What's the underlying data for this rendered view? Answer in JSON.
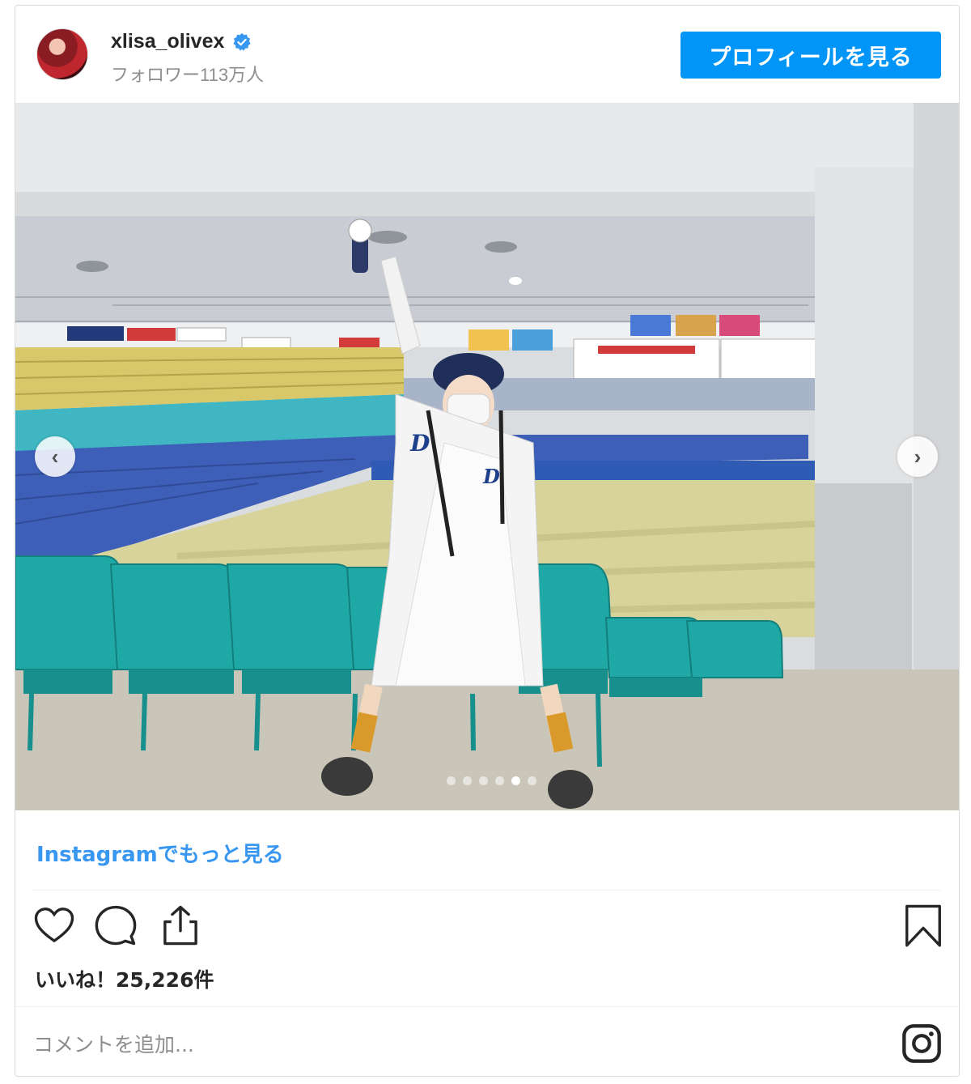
{
  "header": {
    "username": "xlisa_olivex",
    "followers": "フォロワー113万人",
    "profile_button": "プロフィールを見る"
  },
  "carousel": {
    "prev_label": "‹",
    "next_label": "›",
    "dot_count": 6,
    "active_index": 4
  },
  "post": {
    "more_link": "Instagramでもっと見る",
    "likes": "いいね！25,226件",
    "comment_placeholder": "コメントを追加..."
  },
  "colors": {
    "accent": "#0095f6",
    "link": "#3897f0",
    "seat_teal": "#1fa9a6"
  },
  "icons": [
    "verified-icon",
    "heart-icon",
    "comment-icon",
    "share-icon",
    "bookmark-icon",
    "instagram-icon"
  ]
}
